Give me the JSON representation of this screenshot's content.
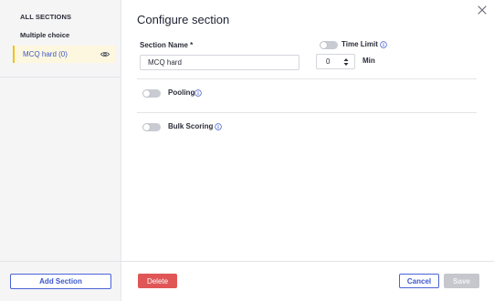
{
  "sidebar": {
    "header": "ALL SECTIONS",
    "group_label": "Multiple choice",
    "items": [
      {
        "label": "MCQ hard (0)",
        "icon": "eye-icon",
        "selected": true
      }
    ],
    "add_section_label": "Add Section"
  },
  "dialog": {
    "title": "Configure section",
    "close_icon": "close-icon"
  },
  "form": {
    "section_name_label": "Section Name *",
    "section_name_value": "MCQ hard",
    "time_limit": {
      "label": "Time Limit",
      "enabled": false,
      "value": "0",
      "unit": "Min"
    },
    "pooling": {
      "label": "Pooling",
      "enabled": false
    },
    "bulk_scoring": {
      "label": "Bulk Scoring",
      "enabled": false
    }
  },
  "footer": {
    "delete_label": "Delete",
    "cancel_label": "Cancel",
    "save_label": "Save"
  },
  "colors": {
    "accent": "#3a56cf",
    "selected_bg": "#fdf7df",
    "selected_border": "#f1c21b",
    "danger": "#e05656",
    "disabled": "#c5c7cd"
  }
}
